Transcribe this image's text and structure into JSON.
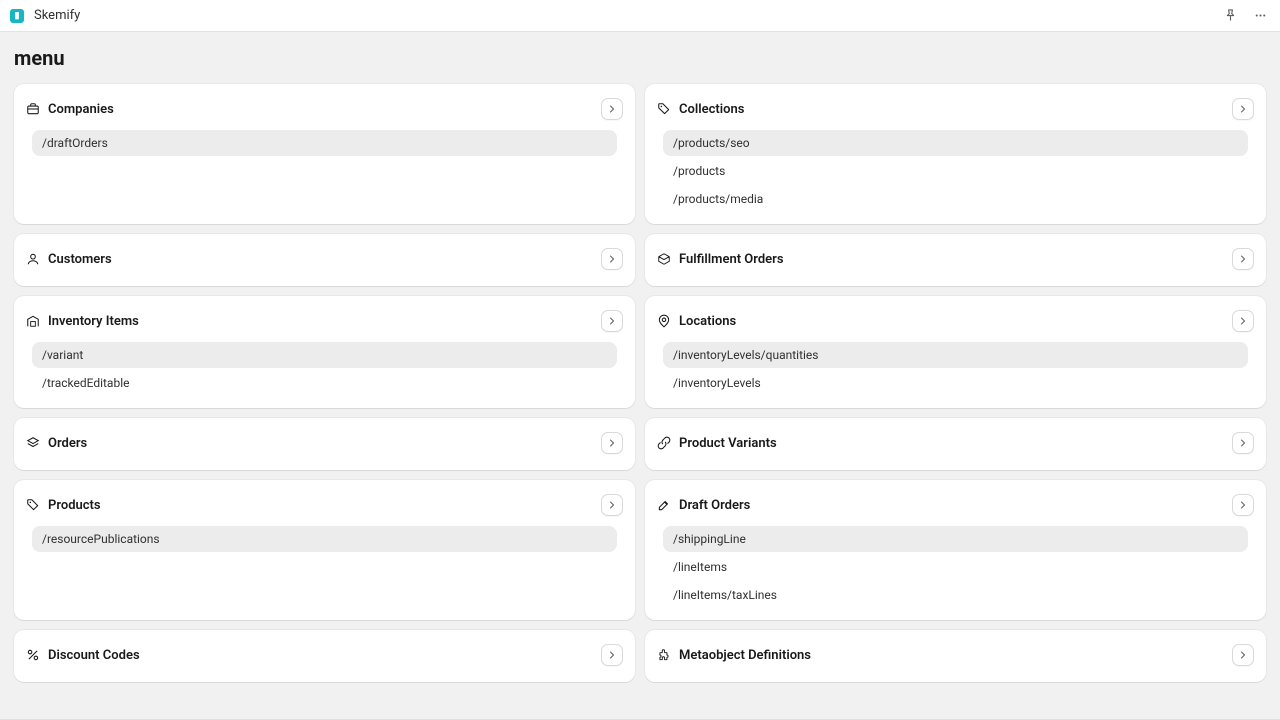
{
  "app_name": "Skemify",
  "page_title": "menu",
  "cards": {
    "companies": {
      "title": "Companies",
      "items": [
        {
          "path": "/draftOrders",
          "active": true
        }
      ]
    },
    "collections": {
      "title": "Collections",
      "items": [
        {
          "path": "/products/seo",
          "active": true
        },
        {
          "path": "/products",
          "active": false
        },
        {
          "path": "/products/media",
          "active": false
        }
      ]
    },
    "customers": {
      "title": "Customers",
      "items": []
    },
    "fulfillment_orders": {
      "title": "Fulfillment Orders",
      "items": []
    },
    "inventory_items": {
      "title": "Inventory Items",
      "items": [
        {
          "path": "/variant",
          "active": true
        },
        {
          "path": "/trackedEditable",
          "active": false
        }
      ]
    },
    "locations": {
      "title": "Locations",
      "items": [
        {
          "path": "/inventoryLevels/quantities",
          "active": true
        },
        {
          "path": "/inventoryLevels",
          "active": false
        }
      ]
    },
    "orders": {
      "title": "Orders",
      "items": []
    },
    "product_variants": {
      "title": "Product Variants",
      "items": []
    },
    "products": {
      "title": "Products",
      "items": [
        {
          "path": "/resourcePublications",
          "active": true
        }
      ]
    },
    "draft_orders": {
      "title": "Draft Orders",
      "items": [
        {
          "path": "/shippingLine",
          "active": true
        },
        {
          "path": "/lineItems",
          "active": false
        },
        {
          "path": "/lineItems/taxLines",
          "active": false
        }
      ]
    },
    "discount_codes": {
      "title": "Discount Codes",
      "items": []
    },
    "metaobject_definitions": {
      "title": "Metaobject Definitions",
      "items": []
    }
  }
}
